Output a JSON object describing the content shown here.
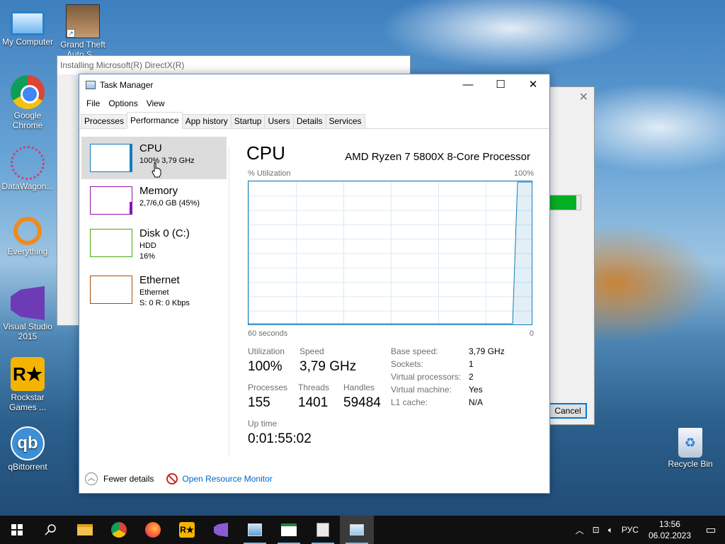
{
  "desktop": {
    "icons": [
      {
        "label": "My Computer",
        "icon": "computer-icon"
      },
      {
        "label": "Grand Theft Auto S...",
        "icon": "gta-icon"
      },
      {
        "label": "Google Chrome",
        "icon": "chrome-icon"
      },
      {
        "label": "DataWagon...",
        "icon": "datawagon-icon"
      },
      {
        "label": "Everything",
        "icon": "everything-icon"
      },
      {
        "label": "Visual Studio 2015",
        "icon": "visual-studio-icon"
      },
      {
        "label": "Rockstar Games ...",
        "icon": "rockstar-icon"
      },
      {
        "label": "qBittorrent",
        "icon": "qbittorrent-icon"
      },
      {
        "label": "Recycle Bin",
        "icon": "recycle-bin-icon"
      }
    ]
  },
  "dx": {
    "title": "Installing Microsoft(R) DirectX(R)",
    "cancel_label": "Cancel",
    "progress": 0.86,
    "progress_color": "#06b025"
  },
  "taskmanager": {
    "title": "Task Manager",
    "menu": [
      "File",
      "Options",
      "View"
    ],
    "tabs": [
      "Processes",
      "Performance",
      "App history",
      "Startup",
      "Users",
      "Details",
      "Services"
    ],
    "active_tab": "Performance",
    "resources": [
      {
        "name": "CPU",
        "line1": "100%  3,79 GHz",
        "line2": "",
        "color": "#117dbb"
      },
      {
        "name": "Memory",
        "line1": "2,7/6,0 GB (45%)",
        "line2": "",
        "color": "#8b12ae"
      },
      {
        "name": "Disk 0 (C:)",
        "line1": "HDD",
        "line2": "16%",
        "color": "#4da60c"
      },
      {
        "name": "Ethernet",
        "line1": "Ethernet",
        "line2": "S: 0  R: 0 Kbps",
        "color": "#a74f01"
      }
    ],
    "cpu": {
      "heading": "CPU",
      "model": "AMD Ryzen 7 5800X 8-Core Processor",
      "util_label": "% Utilization",
      "max_label": "100%",
      "time_label": "60 seconds",
      "zero_label": "0",
      "utilization_label": "Utilization",
      "utilization": "100%",
      "speed_label": "Speed",
      "speed": "3,79 GHz",
      "processes_label": "Processes",
      "processes": "155",
      "threads_label": "Threads",
      "threads": "1401",
      "handles_label": "Handles",
      "handles": "59484",
      "uptime_label": "Up time",
      "uptime": "0:01:55:02",
      "details": [
        {
          "label": "Base speed:",
          "value": "3,79 GHz"
        },
        {
          "label": "Sockets:",
          "value": "1"
        },
        {
          "label": "Virtual processors:",
          "value": "2"
        },
        {
          "label": "Virtual machine:",
          "value": "Yes"
        },
        {
          "label": "L1 cache:",
          "value": "N/A"
        }
      ],
      "graph_color": "#117dbb"
    },
    "footer": {
      "fewer_details": "Fewer details",
      "resource_monitor": "Open Resource Monitor"
    }
  },
  "taskbar": {
    "language": "РУС",
    "time": "13:56",
    "date": "06.02.2023",
    "apps": [
      "explorer-icon",
      "chrome-icon",
      "firefox-icon",
      "rockstar-icon",
      "visual-studio-icon",
      "installer-icon",
      "notepad-icon",
      "files-icon",
      "task-manager-icon"
    ]
  }
}
